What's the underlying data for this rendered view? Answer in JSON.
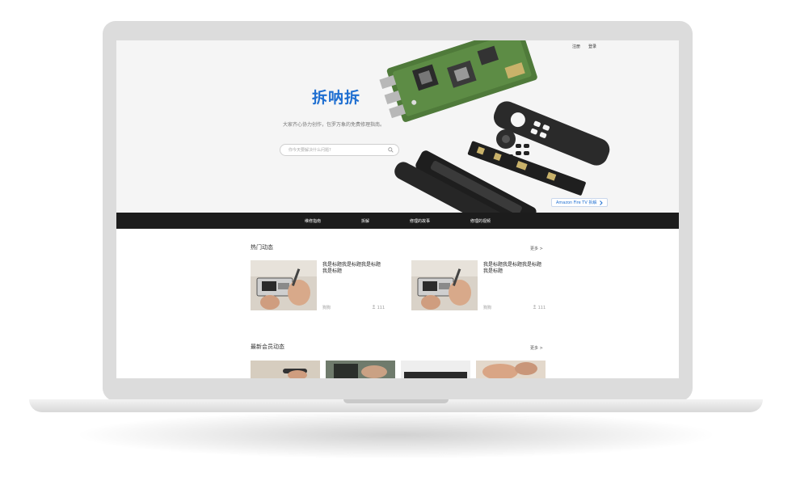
{
  "header": {
    "links": [
      "注册",
      "登录"
    ]
  },
  "hero": {
    "brand": "拆呐拆",
    "tagline": "大家齐心协力创作，包罗万象的免费修理指南。",
    "search_placeholder": "你今天要解决什么问题?",
    "promo_label": "Amazon Fire TV 拆解"
  },
  "nav": {
    "items": [
      "维修指南",
      "拆解",
      "修理的故事",
      "修理的视频"
    ]
  },
  "hot": {
    "title": "热门动态",
    "more": "更多 >",
    "cards": [
      {
        "title": "我是标题我是标题我是标题我是标题",
        "author": "狗狗",
        "count": "111"
      },
      {
        "title": "我是标题我是标题我是标题我是标题",
        "author": "狗狗",
        "count": "111"
      }
    ]
  },
  "members": {
    "title": "最新会员动态",
    "more": "更多 >"
  },
  "colors": {
    "brand": "#1f6fd1",
    "navbar": "#1c1c1c",
    "hero_bg": "#f5f5f5",
    "laptop": "#dcdcdc"
  },
  "icons": {
    "search": "search-icon",
    "chevron": "chevron-right-icon"
  }
}
